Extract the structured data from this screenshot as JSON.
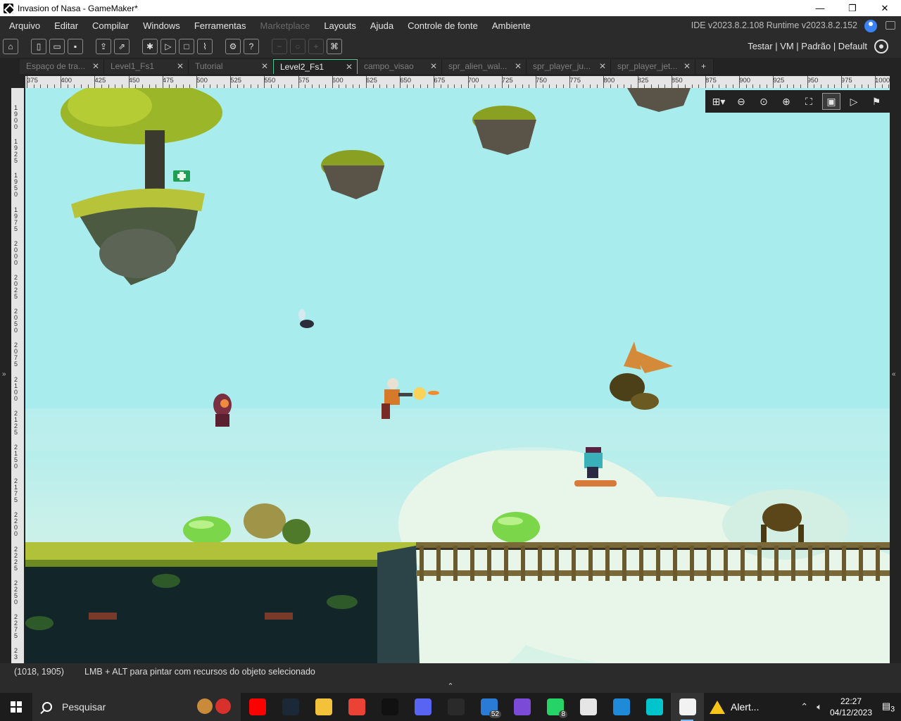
{
  "window": {
    "title": "Invasion of Nasa - GameMaker*",
    "controls": [
      "—",
      "❐",
      "✕"
    ]
  },
  "menu": {
    "items": [
      "Arquivo",
      "Editar",
      "Compilar",
      "Windows",
      "Ferramentas",
      "Marketplace",
      "Layouts",
      "Ajuda",
      "Controle de fonte",
      "Ambiente"
    ],
    "disabled_item": "Marketplace",
    "version": "IDE v2023.8.2.108  Runtime v2023.8.2.152"
  },
  "toolbar": {
    "right_label": "Testar | VM | Padrão | Default"
  },
  "tabs": [
    {
      "label": "Espaço de tra...",
      "active": false
    },
    {
      "label": "Level1_Fs1",
      "active": false
    },
    {
      "label": "Tutorial",
      "active": false
    },
    {
      "label": "Level2_Fs1",
      "active": true
    },
    {
      "label": "campo_visao",
      "active": false
    },
    {
      "label": "spr_alien_wal...",
      "active": false
    },
    {
      "label": "spr_player_ju...",
      "active": false
    },
    {
      "label": "spr_player_jet...",
      "active": false
    }
  ],
  "tab_add": "+",
  "ruler_top": [
    "375",
    "400",
    "425",
    "450",
    "475",
    "500",
    "525",
    "550",
    "575",
    "600",
    "625",
    "650",
    "675",
    "700",
    "725",
    "750",
    "775",
    "800",
    "825",
    "850",
    "875",
    "900",
    "925",
    "950",
    "975",
    "1000"
  ],
  "ruler_left": [
    "1900",
    "1925",
    "1950",
    "1975",
    "2000",
    "2025",
    "2050",
    "2075",
    "2100",
    "2125",
    "2150",
    "2175",
    "2200",
    "2225",
    "2250",
    "2275",
    "23"
  ],
  "side_arrows": {
    "left": "»",
    "right": "«"
  },
  "status": {
    "coords": "(1018, 1905)",
    "hint": "LMB + ALT para pintar com recursos do objeto selecionado",
    "collapse": "⌃"
  },
  "taskbar": {
    "search_placeholder": "Pesquisar",
    "apps": [
      {
        "icon": "youtube-icon",
        "color": "#ff0000"
      },
      {
        "icon": "steam-icon",
        "color": "#1b2838"
      },
      {
        "icon": "folder-icon",
        "color": "#f3c13a"
      },
      {
        "icon": "gmail-icon",
        "color": "#ea4335"
      },
      {
        "icon": "tiktok-icon",
        "color": "#111111"
      },
      {
        "icon": "discord-icon",
        "color": "#5865f2"
      },
      {
        "icon": "epic-games-icon",
        "color": "#2a2a2a"
      },
      {
        "icon": "mail-icon",
        "color": "#2a7bd5",
        "badge": "52"
      },
      {
        "icon": "crown-icon",
        "color": "#7b4bd8"
      },
      {
        "icon": "whatsapp-icon",
        "color": "#25d366",
        "badge": "8"
      },
      {
        "icon": "ubisoft-icon",
        "color": "#e6e6e6"
      },
      {
        "icon": "edge-icon",
        "color": "#1f8ad8"
      },
      {
        "icon": "canva-icon",
        "color": "#00c4cc"
      },
      {
        "icon": "gamemaker-icon",
        "color": "#f2f2f2"
      }
    ],
    "alert_label": "Alert...",
    "time": "22:27",
    "date": "04/12/2023",
    "notifications": "3"
  },
  "colors": {
    "accent": "#4ec996",
    "sky": "#a8eced",
    "grass": "#b7c43a",
    "slime": "#7bd64a"
  }
}
